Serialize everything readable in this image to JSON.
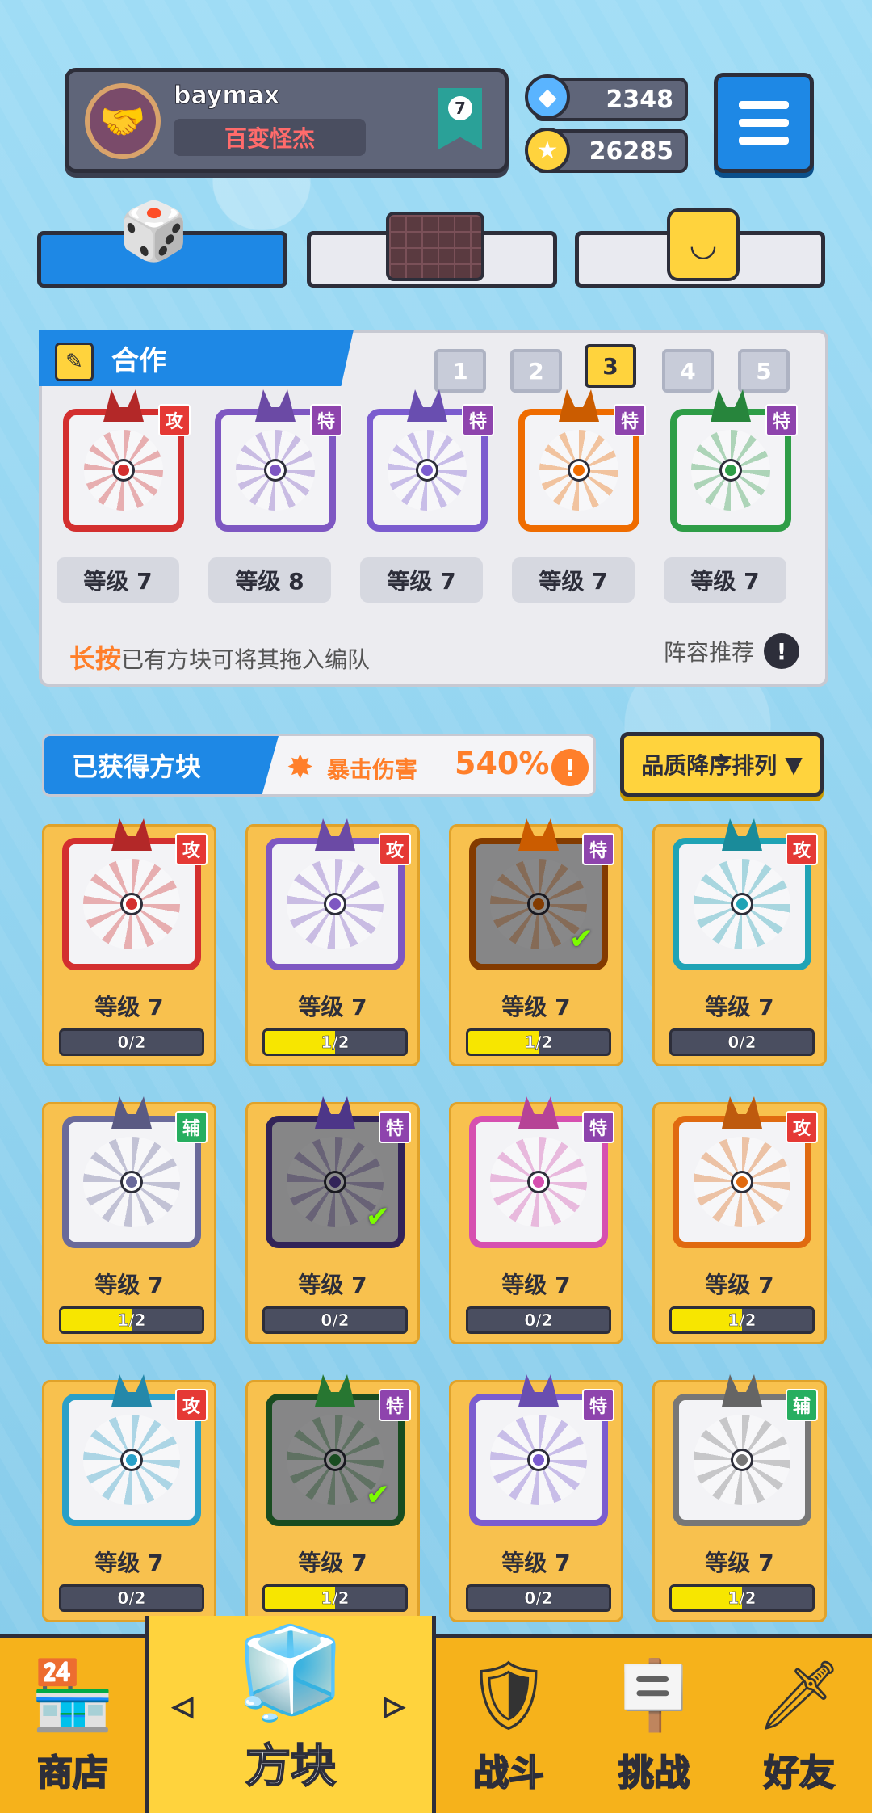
{
  "profile": {
    "username": "baymax",
    "title": "百变怪杰",
    "rank": "7",
    "avatar_icon": "handshake-icon"
  },
  "currency": {
    "gems": "2348",
    "coins": "26285"
  },
  "mode_tabs": [
    {
      "name": "dice",
      "icon": "dice-icon",
      "active": true
    },
    {
      "name": "board",
      "icon": "grid-board-icon",
      "active": false
    },
    {
      "name": "emote",
      "icon": "smile-block-icon",
      "active": false
    }
  ],
  "team": {
    "header": "合作",
    "pages": [
      "1",
      "2",
      "3",
      "4",
      "5"
    ],
    "active_page": "3",
    "cards": [
      {
        "tag": "攻",
        "tag_type": "atk",
        "color": "#d32f2f",
        "level": "等级 7"
      },
      {
        "tag": "特",
        "tag_type": "spe",
        "color": "#7e57c2",
        "level": "等级 8"
      },
      {
        "tag": "特",
        "tag_type": "spe",
        "color": "#7b5ccf",
        "level": "等级 7"
      },
      {
        "tag": "特",
        "tag_type": "spe",
        "color": "#ef6c00",
        "level": "等级 7"
      },
      {
        "tag": "特",
        "tag_type": "spe",
        "color": "#2e9d47",
        "level": "等级 7"
      }
    ],
    "hint_bold": "长按",
    "hint_rest": "已有方块可将其拖入编队",
    "recommend": "阵容推荐"
  },
  "collection": {
    "title": "已获得方块",
    "crit_label": "暴击伤害",
    "crit_value": "540%",
    "sort_label": "品质降序排列",
    "cards": [
      {
        "tag": "攻",
        "tag_type": "atk",
        "color": "#d32f2f",
        "level": "等级 7",
        "progress": "0/2",
        "fill": 0,
        "in_team": false
      },
      {
        "tag": "攻",
        "tag_type": "atk",
        "color": "#7e57c2",
        "level": "等级 7",
        "progress": "1/2",
        "fill": 0.5,
        "in_team": false
      },
      {
        "tag": "特",
        "tag_type": "spe",
        "color": "#ef6c00",
        "level": "等级 7",
        "progress": "1/2",
        "fill": 0.5,
        "in_team": true
      },
      {
        "tag": "攻",
        "tag_type": "atk",
        "color": "#1fa3b5",
        "level": "等级 7",
        "progress": "0/2",
        "fill": 0,
        "in_team": false
      },
      {
        "tag": "辅",
        "tag_type": "sup",
        "color": "#6a6a9a",
        "level": "等级 7",
        "progress": "1/2",
        "fill": 0.5,
        "in_team": false
      },
      {
        "tag": "特",
        "tag_type": "spe",
        "color": "#5b3fa0",
        "level": "等级 7",
        "progress": "0/2",
        "fill": 0,
        "in_team": true
      },
      {
        "tag": "特",
        "tag_type": "spe",
        "color": "#d64fb0",
        "level": "等级 7",
        "progress": "0/2",
        "fill": 0,
        "in_team": false
      },
      {
        "tag": "攻",
        "tag_type": "atk",
        "color": "#e06a10",
        "level": "等级 7",
        "progress": "1/2",
        "fill": 0.5,
        "in_team": false
      },
      {
        "tag": "攻",
        "tag_type": "atk",
        "color": "#2aa0c8",
        "level": "等级 7",
        "progress": "0/2",
        "fill": 0,
        "in_team": false
      },
      {
        "tag": "特",
        "tag_type": "spe",
        "color": "#2e8b3a",
        "level": "等级 7",
        "progress": "1/2",
        "fill": 0.5,
        "in_team": true
      },
      {
        "tag": "特",
        "tag_type": "spe",
        "color": "#7b5ccf",
        "level": "等级 7",
        "progress": "0/2",
        "fill": 0,
        "in_team": false
      },
      {
        "tag": "辅",
        "tag_type": "sup",
        "color": "#777777",
        "level": "等级 7",
        "progress": "1/2",
        "fill": 0.5,
        "in_team": false
      }
    ]
  },
  "nav": [
    {
      "label": "商店",
      "icon": "shop-icon",
      "active": false
    },
    {
      "label": "方块",
      "icon": "mystery-cube-icon",
      "active": true
    },
    {
      "label": "战斗",
      "icon": "battle-icon",
      "active": false
    },
    {
      "label": "挑战",
      "icon": "challenge-icon",
      "active": false
    },
    {
      "label": "好友",
      "icon": "friends-icon",
      "active": false
    }
  ],
  "colors": {
    "accent": "#1e88e5",
    "gold": "#ffd33d",
    "orange": "#ff7f2a",
    "panel": "#f8c14e"
  }
}
